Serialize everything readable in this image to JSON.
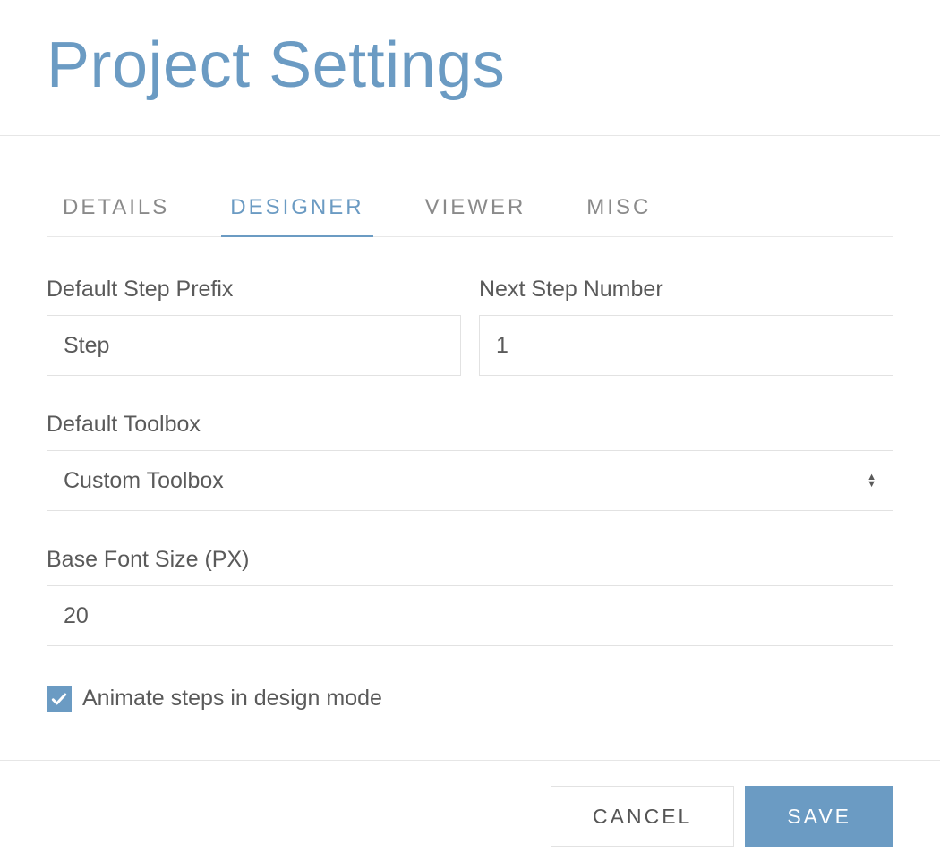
{
  "title": "Project Settings",
  "tabs": {
    "details": {
      "label": "DETAILS"
    },
    "designer": {
      "label": "DESIGNER"
    },
    "viewer": {
      "label": "VIEWER"
    },
    "misc": {
      "label": "MISC"
    }
  },
  "form": {
    "default_step_prefix": {
      "label": "Default Step Prefix",
      "value": "Step"
    },
    "next_step_number": {
      "label": "Next Step Number",
      "value": "1"
    },
    "default_toolbox": {
      "label": "Default Toolbox",
      "value": "Custom Toolbox"
    },
    "base_font_size": {
      "label": "Base Font Size (PX)",
      "value": "20"
    },
    "animate_steps": {
      "label": "Animate steps in design mode",
      "checked": true
    }
  },
  "buttons": {
    "cancel": "CANCEL",
    "save": "SAVE"
  }
}
